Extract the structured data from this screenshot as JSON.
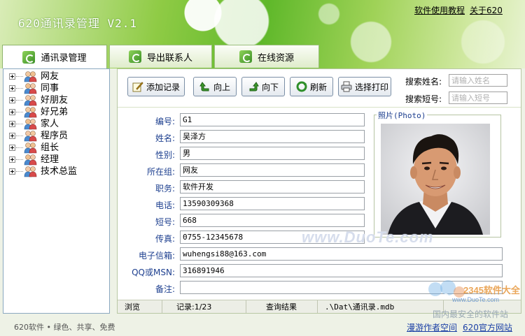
{
  "app": {
    "title": "620通讯录管理 V2.1",
    "help_link": "软件使用教程",
    "about_link": "关于620"
  },
  "tabs": [
    {
      "label": "通讯录管理",
      "active": true,
      "icon": "refresh-icon"
    },
    {
      "label": "导出联系人",
      "active": false,
      "icon": "refresh-icon"
    },
    {
      "label": "在线资源",
      "active": false,
      "icon": "refresh-icon"
    }
  ],
  "tree": {
    "items": [
      {
        "label": "网友"
      },
      {
        "label": "同事"
      },
      {
        "label": "好朋友"
      },
      {
        "label": "好兄弟"
      },
      {
        "label": "家人"
      },
      {
        "label": "程序员"
      },
      {
        "label": "组长"
      },
      {
        "label": "经理"
      },
      {
        "label": "技术总监"
      }
    ]
  },
  "toolbar": {
    "add_label": "添加记录",
    "up_label": "向上",
    "down_label": "向下",
    "refresh_label": "刷新",
    "print_label": "选择打印",
    "search_name_label": "搜索姓名:",
    "search_name_placeholder": "请输入姓名",
    "search_short_label": "搜索短号:",
    "search_short_placeholder": "请输入短号"
  },
  "form": {
    "fields": [
      {
        "label": "编号:",
        "value": "G1"
      },
      {
        "label": "姓名:",
        "value": "吴泽方"
      },
      {
        "label": "性别:",
        "value": "男"
      },
      {
        "label": "所在组:",
        "value": "网友"
      },
      {
        "label": "职务:",
        "value": "软件开发"
      },
      {
        "label": "电话:",
        "value": "13590309368"
      },
      {
        "label": "短号:",
        "value": "668"
      },
      {
        "label": "传真:",
        "value": "0755-12345678"
      },
      {
        "label": "电子信箱:",
        "value": "wuhengsi88@163.com"
      },
      {
        "label": "QQ或MSN:",
        "value": "316891946"
      },
      {
        "label": "备注:",
        "value": ""
      }
    ],
    "photo_label": "照片(Photo)"
  },
  "status": {
    "mode": "浏览",
    "record": "记录:1/23",
    "query": "查询结果",
    "path": ".\\Dat\\通讯录.mdb"
  },
  "watermark": "www.DuoTe.com",
  "footer": {
    "slogan": "620软件 • 绿色、共享、免费",
    "author_link": "漫游作者空间",
    "site_link": "620官方网站"
  },
  "brand": {
    "name": "2345软件大全",
    "url": "www.DuoTe.com",
    "tagline": "国内最安全的软件站"
  },
  "colors": {
    "header_green": "#5fb82a",
    "label_blue": "#1d3f8f",
    "link_blue": "#1a3fa5"
  }
}
